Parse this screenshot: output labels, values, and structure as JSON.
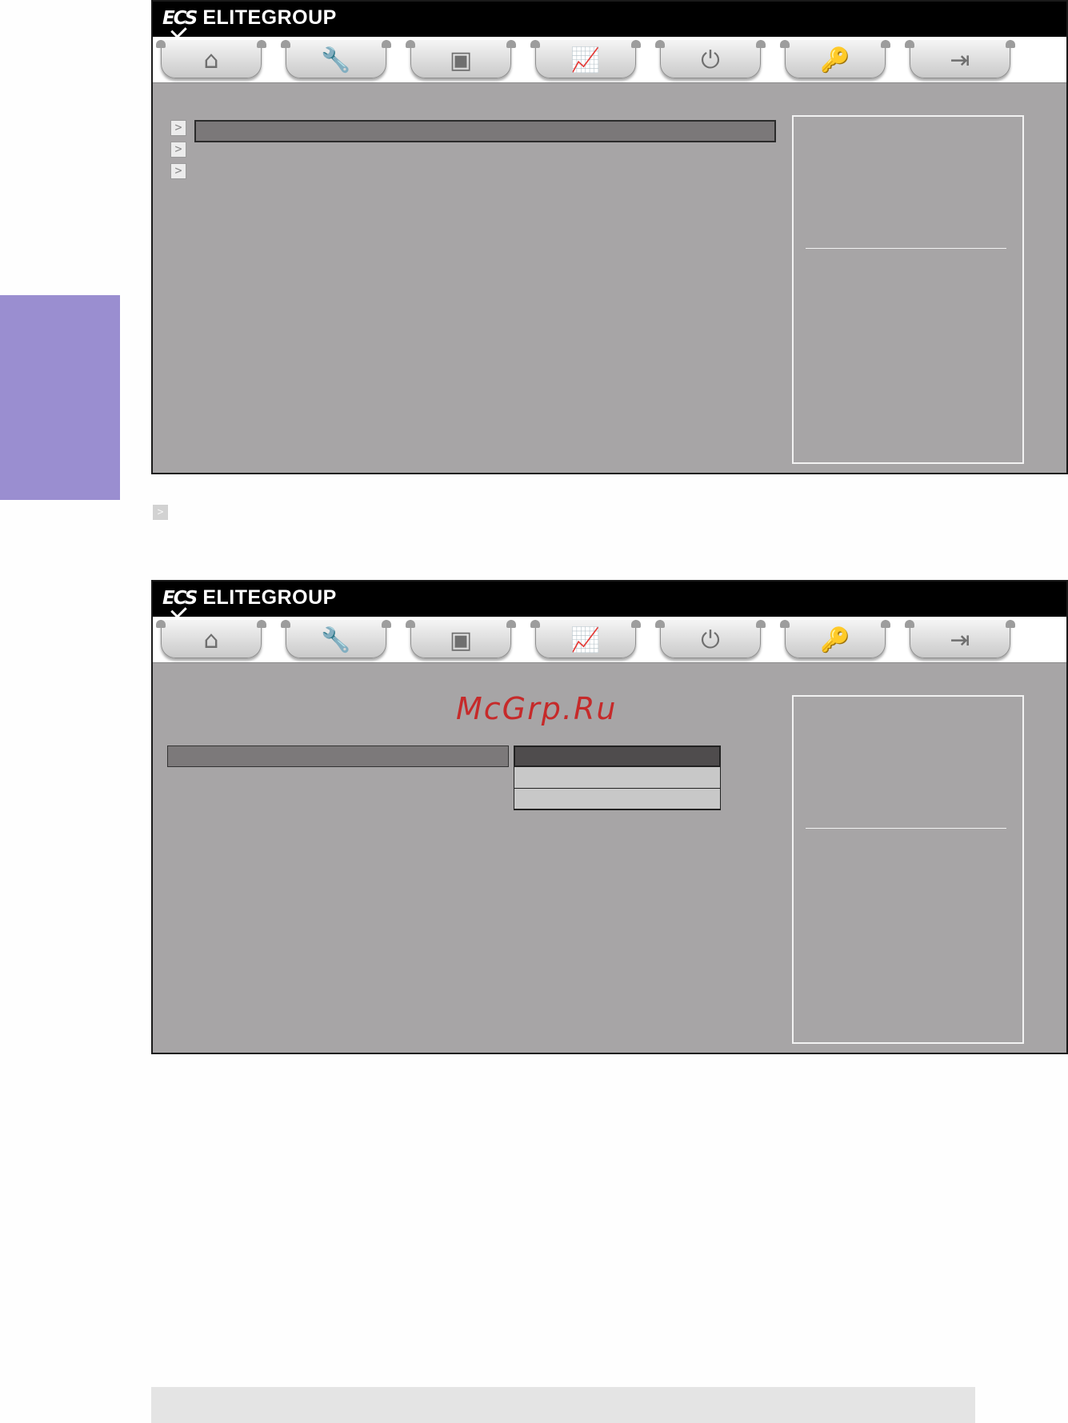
{
  "brand": {
    "mark": "ECS",
    "name": "ELITEGROUP"
  },
  "tabs": [
    {
      "name": "home",
      "icon": "home-icon",
      "glyph": "⌂"
    },
    {
      "name": "settings",
      "icon": "wrench-icon",
      "glyph": "🔧"
    },
    {
      "name": "chipset",
      "icon": "chip-icon",
      "glyph": "▣"
    },
    {
      "name": "performance",
      "icon": "chart-icon",
      "glyph": "📈"
    },
    {
      "name": "power",
      "icon": "power-icon",
      "glyph": "⏻"
    },
    {
      "name": "security",
      "icon": "key-icon",
      "glyph": "🔑"
    },
    {
      "name": "exit",
      "icon": "exit-icon",
      "glyph": "⇥"
    }
  ],
  "screen1": {
    "menu_arrows": [
      ">",
      ">",
      ">"
    ]
  },
  "screen2": {
    "dropdown_items": 3
  },
  "inline_arrow": ">",
  "watermark": "McGrp.Ru",
  "colors": {
    "side_tab": "#9a8ed0",
    "panel_bg": "#a7a5a6",
    "header_bg": "#000000",
    "watermark": "#c62a2a"
  }
}
